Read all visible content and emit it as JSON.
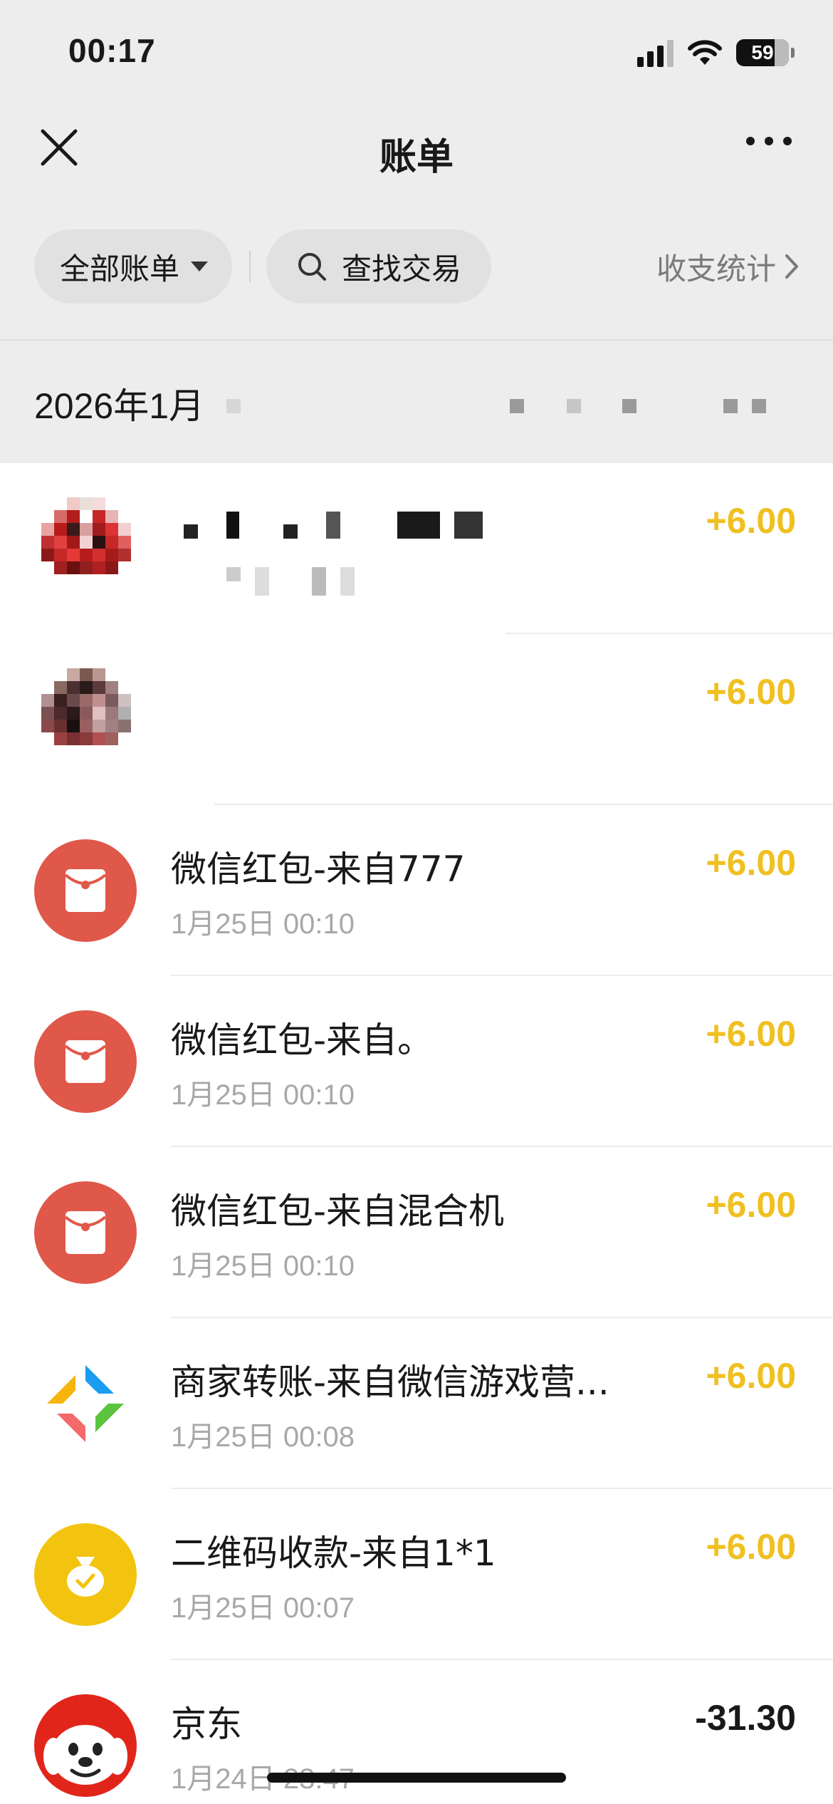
{
  "status_bar": {
    "time": "00:17",
    "battery": "59"
  },
  "nav": {
    "title": "账单"
  },
  "filters": {
    "all_bills": "全部账单",
    "search": "查找交易",
    "stats": "收支统计"
  },
  "month_header": "2026年1月",
  "colors": {
    "positive": "#f0c021",
    "red_packet": "#e0584a",
    "merchant_yellow": "#f3c40f",
    "jd_red": "#e1251b"
  },
  "transactions": [
    {
      "title": "",
      "time": "",
      "amount": "+6.00",
      "icon": "redacted-avatar"
    },
    {
      "title": "",
      "time": "",
      "amount": "+6.00",
      "icon": "redacted-avatar"
    },
    {
      "title": "微信红包-来自777",
      "time": "1月25日 00:10",
      "amount": "+6.00",
      "icon": "red-packet-icon"
    },
    {
      "title": "微信红包-来自。",
      "time": "1月25日 00:10",
      "amount": "+6.00",
      "icon": "red-packet-icon"
    },
    {
      "title": "微信红包-来自混合机",
      "time": "1月25日 00:10",
      "amount": "+6.00",
      "icon": "red-packet-icon"
    },
    {
      "title": "商家转账-来自微信游戏营...",
      "time": "1月25日 00:08",
      "amount": "+6.00",
      "icon": "merchant-transfer-icon"
    },
    {
      "title": "二维码收款-来自1*1",
      "time": "1月25日 00:07",
      "amount": "+6.00",
      "icon": "qr-collect-icon"
    },
    {
      "title": "京东",
      "time": "1月24日 23:47",
      "amount": "-31.30",
      "icon": "jd-icon"
    }
  ]
}
